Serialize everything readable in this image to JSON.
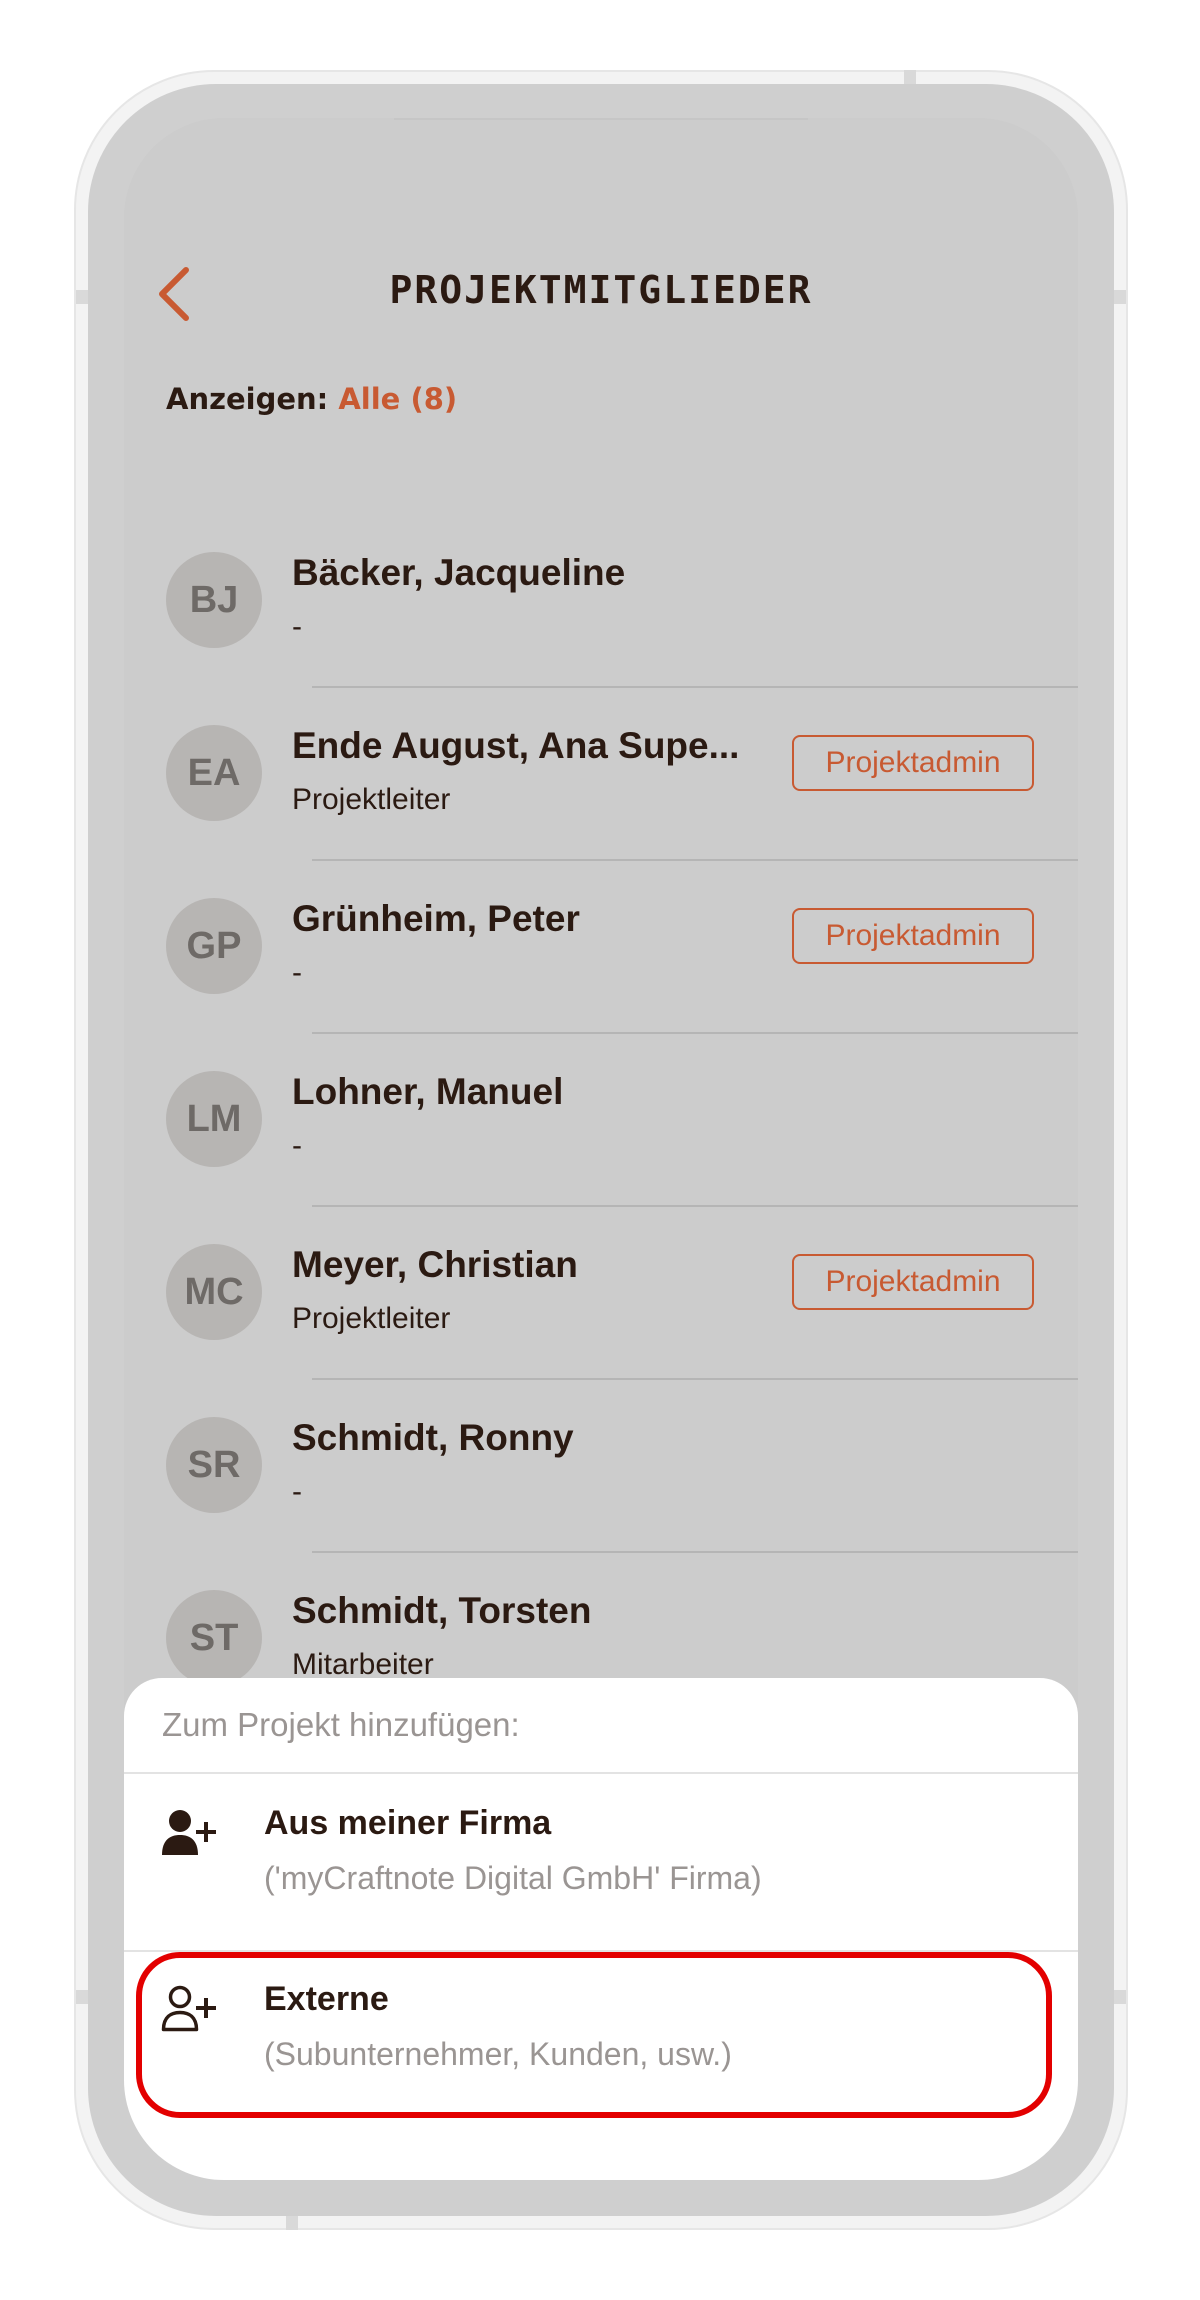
{
  "header": {
    "title": "PROJEKTMITGLIEDER"
  },
  "filter": {
    "label": "Anzeigen:",
    "value": "Alle (8)"
  },
  "members": [
    {
      "initials": "BJ",
      "name": "Bäcker, Jacqueline",
      "role": "-",
      "badge": ""
    },
    {
      "initials": "EA",
      "name": "Ende August, Ana Supe...",
      "role": "Projektleiter",
      "badge": "Projektadmin"
    },
    {
      "initials": "GP",
      "name": "Grünheim, Peter",
      "role": "-",
      "badge": "Projektadmin"
    },
    {
      "initials": "LM",
      "name": "Lohner, Manuel",
      "role": "-",
      "badge": ""
    },
    {
      "initials": "MC",
      "name": "Meyer, Christian",
      "role": "Projektleiter",
      "badge": "Projektadmin"
    },
    {
      "initials": "SR",
      "name": "Schmidt, Ronny",
      "role": "-",
      "badge": ""
    },
    {
      "initials": "ST",
      "name": "Schmidt, Torsten",
      "role": "Mitarbeiter",
      "badge": ""
    }
  ],
  "sheet": {
    "title": "Zum Projekt hinzufügen:",
    "options": [
      {
        "icon": "add-user-icon",
        "title": "Aus meiner Firma",
        "subtitle": "('myCraftnote Digital GmbH' Firma)"
      },
      {
        "icon": "add-user-icon",
        "title": "Externe",
        "subtitle": "(Subunternehmer, Kunden, usw.)"
      }
    ]
  },
  "colors": {
    "accent": "#c85a32",
    "text_dark": "#2b1a12",
    "overlay_bg": "#cccccc",
    "highlight": "#e30000"
  }
}
